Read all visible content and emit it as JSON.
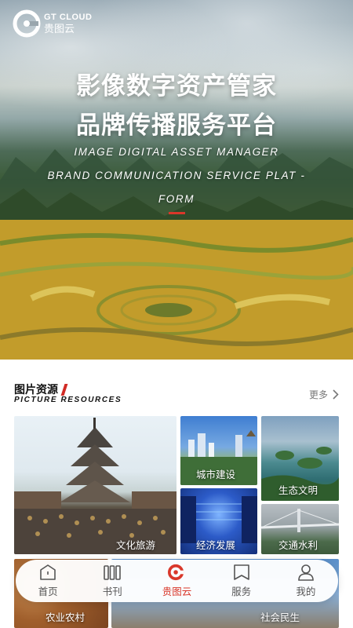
{
  "brand": {
    "en": "GT CLOUD",
    "cn": "贵图云"
  },
  "hero": {
    "title_line1": "影像数字资产管家",
    "title_line2": "品牌传播服务平台",
    "subtitle_line1": "IMAGE DIGITAL ASSET MANAGER",
    "subtitle_line2": "BRAND COMMUNICATION SERVICE PLAT -",
    "subtitle_line3": "FORM"
  },
  "section": {
    "title_cn": "图片资源",
    "title_en": "PICTURE RESOURCES",
    "more_label": "更多"
  },
  "tiles": {
    "culture": "文化旅游",
    "city": "城市建设",
    "eco": "生态文明",
    "economy": "经济发展",
    "traffic": "交通水利",
    "agri": "农业农村",
    "other": "社会民生"
  },
  "nav": {
    "home": "首页",
    "periodicals": "书刊",
    "gtcloud": "贵图云",
    "service": "服务",
    "mine": "我的"
  },
  "colors": {
    "accent": "#d9372a",
    "text": "#111111",
    "muted": "#777777"
  }
}
